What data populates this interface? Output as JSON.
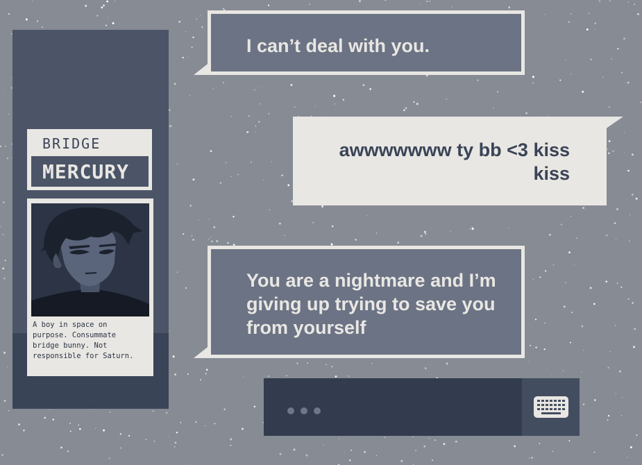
{
  "colors": {
    "background": "#868b94",
    "panel": "#4b5567",
    "panel_dark": "#3a4457",
    "card": "#e9e7e3",
    "npc_bubble": "#6b7384",
    "input_bar": "#323c4e",
    "keyboard_button": "#434d60"
  },
  "profile": {
    "role": "BRIDGE",
    "name": "MERCURY",
    "bio": "A boy in space on\npurpose. Consummate\nbridge bunny. Not\nresponsible for Saturn."
  },
  "messages": [
    {
      "speaker": "npc",
      "text": "I can’t deal with you."
    },
    {
      "speaker": "player",
      "text": "awwwwwww ty bb <3 kiss kiss"
    },
    {
      "speaker": "npc",
      "text": "You are a nightmare and I’m giving up trying to save you from yourself"
    }
  ],
  "input": {
    "typing_indicator": "dots",
    "keyboard_icon": "keyboard-icon"
  }
}
